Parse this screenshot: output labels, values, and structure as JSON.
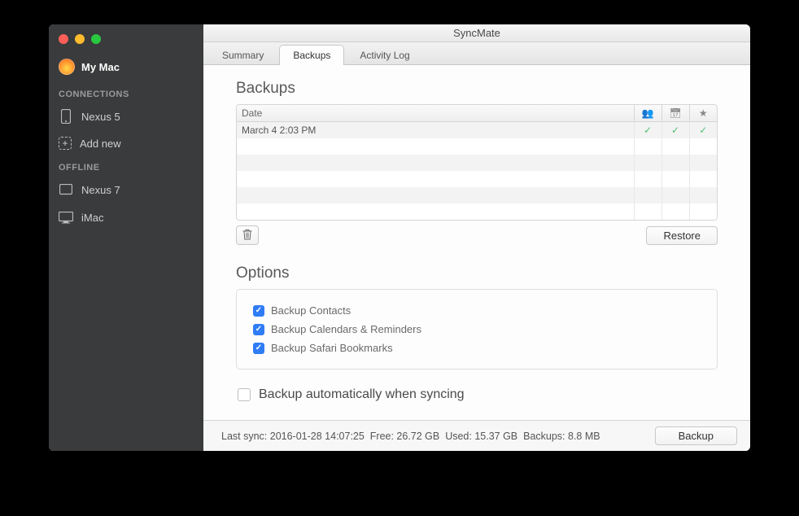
{
  "app_title": "SyncMate",
  "sidebar": {
    "top_label": "My Mac",
    "sections": [
      {
        "title": "CONNECTIONS",
        "items": [
          {
            "label": "Nexus 5",
            "icon": "phone"
          },
          {
            "label": "Add new",
            "icon": "add"
          }
        ]
      },
      {
        "title": "OFFLINE",
        "items": [
          {
            "label": "Nexus 7",
            "icon": "tablet"
          },
          {
            "label": "iMac",
            "icon": "desktop"
          }
        ]
      }
    ]
  },
  "tabs": [
    "Summary",
    "Backups",
    "Activity Log"
  ],
  "active_tab": 1,
  "backups": {
    "heading": "Backups",
    "columns": {
      "date": "Date"
    },
    "rows": [
      {
        "date": "March 4 2:03 PM",
        "contacts": true,
        "calendar": true,
        "bookmarks": true
      }
    ],
    "restore_label": "Restore"
  },
  "options": {
    "heading": "Options",
    "items": [
      {
        "label": "Backup Contacts",
        "checked": true
      },
      {
        "label": "Backup Calendars & Reminders",
        "checked": true
      },
      {
        "label": "Backup Safari Bookmarks",
        "checked": true
      }
    ],
    "auto": {
      "label": "Backup automatically when syncing",
      "checked": false
    }
  },
  "status": {
    "last_sync": "Last sync: 2016-01-28 14:07:25",
    "free": "Free: 26.72 GB",
    "used": "Used: 15.37 GB",
    "backups": "Backups: 8.8 MB",
    "button": "Backup"
  }
}
